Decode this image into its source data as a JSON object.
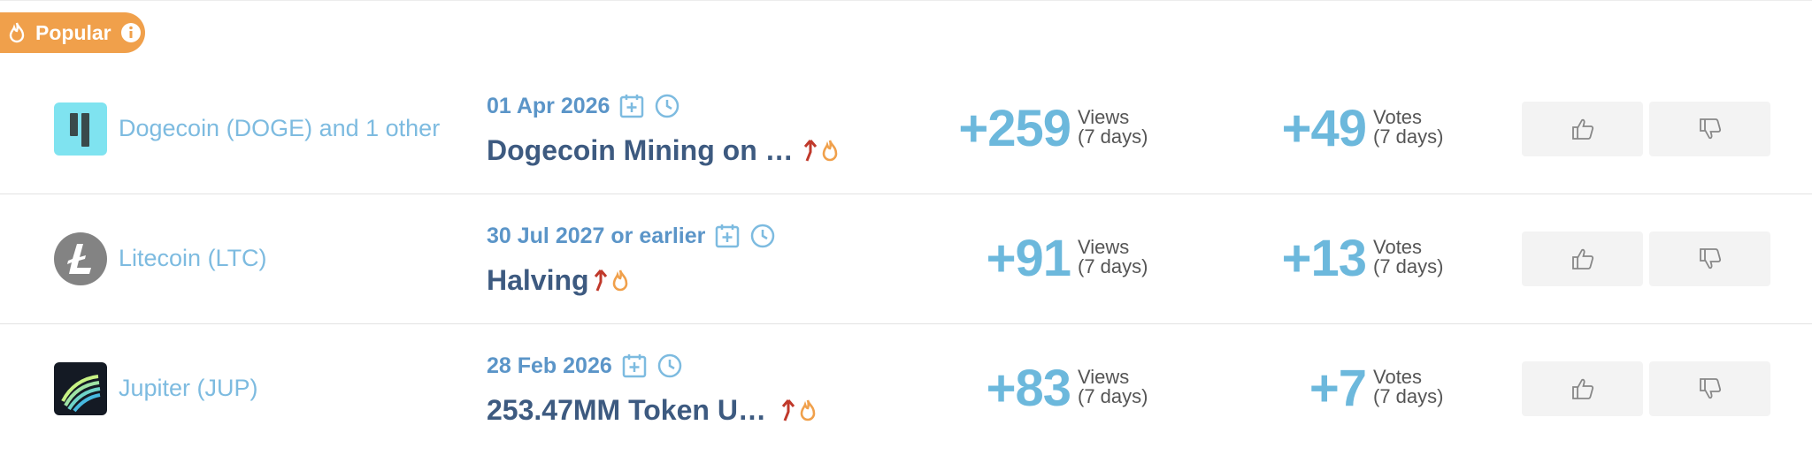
{
  "badge": {
    "label": "Popular",
    "icon": "fire-icon",
    "info_icon": "info-icon",
    "color": "#f0a04b"
  },
  "rows": [
    {
      "coin": "Dogecoin (DOGE) and 1 other",
      "logo": "dogecoin-logo",
      "date": "01 Apr 2026",
      "title": "Dogecoin Mining on …",
      "views": "+259",
      "views_label_1": "Views",
      "views_label_2": "(7 days)",
      "votes": "+49",
      "votes_label_1": "Votes",
      "votes_label_2": "(7 days)"
    },
    {
      "coin": "Litecoin (LTC)",
      "logo": "litecoin-logo",
      "date": "30 Jul 2027 or earlier",
      "title": "Halving",
      "views": "+91",
      "views_label_1": "Views",
      "views_label_2": "(7 days)",
      "votes": "+13",
      "votes_label_1": "Votes",
      "votes_label_2": "(7 days)"
    },
    {
      "coin": "Jupiter (JUP)",
      "logo": "jupiter-logo",
      "date": "28 Feb 2026",
      "title": "253.47MM Token U…",
      "views": "+83",
      "views_label_1": "Views",
      "views_label_2": "(7 days)",
      "votes": "+7",
      "votes_label_1": "Votes",
      "votes_label_2": "(7 days)"
    }
  ],
  "colors": {
    "coin_name": "#7dbbe0",
    "date": "#5b95c8",
    "title": "#3d5a80",
    "numbers": "#6cb8dc",
    "trend_up": "#c0392b",
    "hot": "#f0a04b"
  }
}
